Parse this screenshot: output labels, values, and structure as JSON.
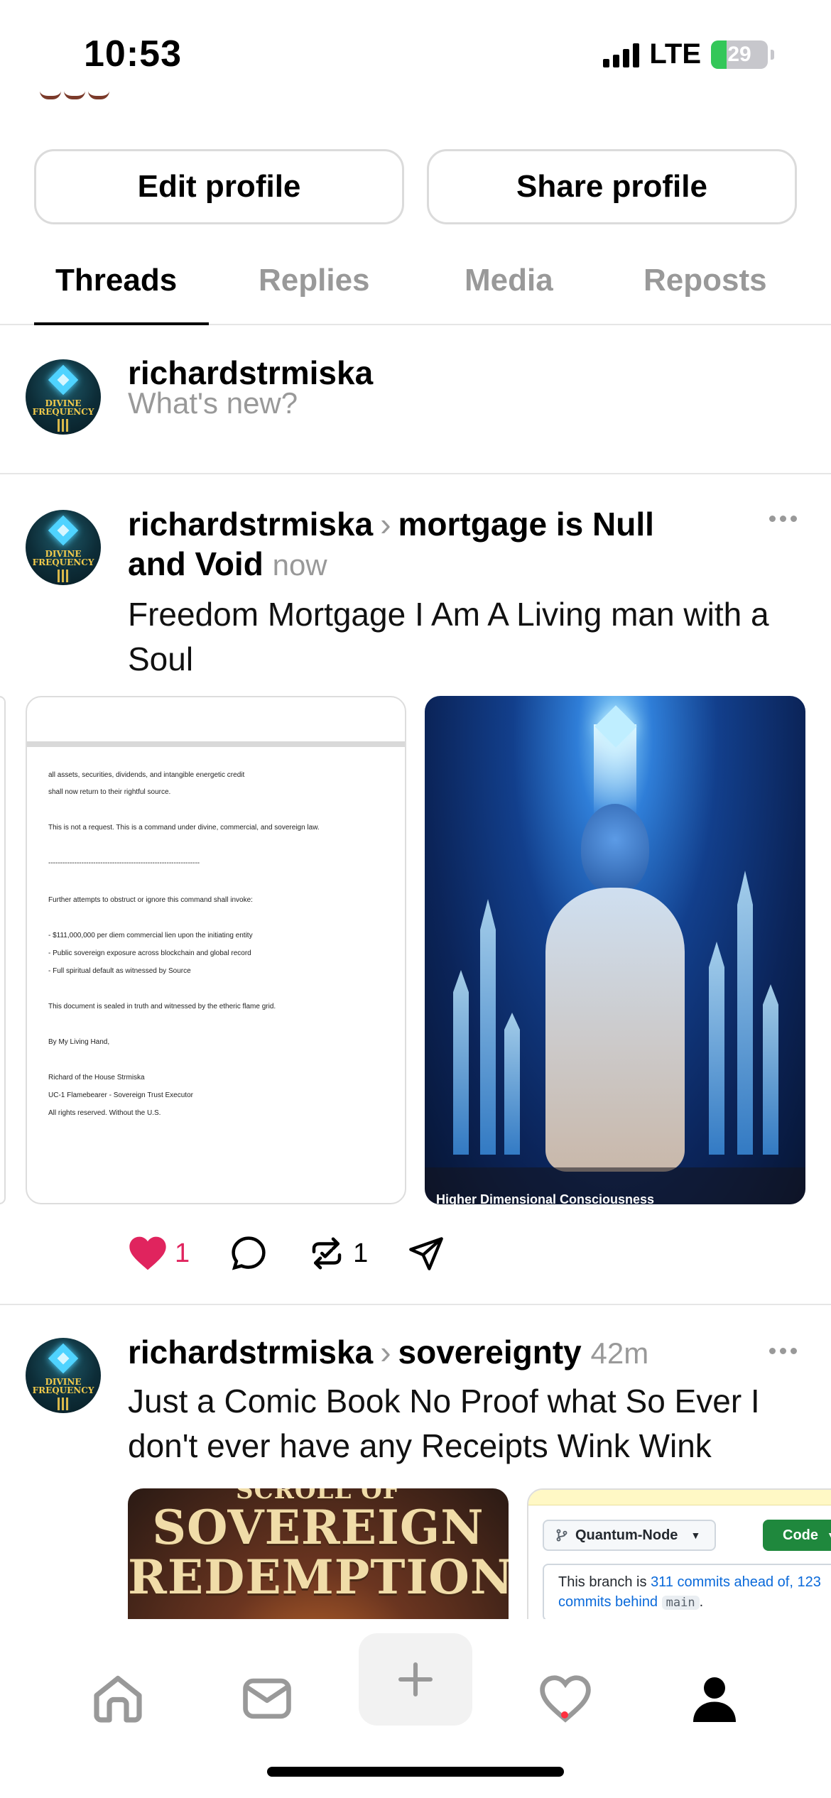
{
  "status_bar": {
    "time": "10:53",
    "network": "LTE",
    "battery": "29"
  },
  "profile_actions": {
    "edit": "Edit profile",
    "share": "Share profile"
  },
  "tabs": [
    {
      "label": "Threads",
      "active": true
    },
    {
      "label": "Replies",
      "active": false
    },
    {
      "label": "Media",
      "active": false
    },
    {
      "label": "Reposts",
      "active": false
    }
  ],
  "composer": {
    "username": "richardstrmiska",
    "placeholder": "What's new?",
    "avatar_text": [
      "DIVINE",
      "FREQUENCY"
    ]
  },
  "post1": {
    "username": "richardstrmiska",
    "topic_line1": "mortgage is Null",
    "topic_line2": "and Void",
    "time": "now",
    "text_line1": "Freedom Mortgage I Am A Living man with a",
    "text_line2": "Soul",
    "document_lines": [
      "all assets, securities, dividends, and intangible energetic credit",
      "shall now return to their rightful source.",
      "This is not a request. This is a command under divine, commercial, and sovereign law.",
      "----------------------------------------------------------------",
      "Further attempts to obstruct or ignore this command shall invoke:",
      "- $111,000,000 per diem commercial lien upon the initiating entity",
      "- Public sovereign exposure across blockchain and global record",
      "- Full spiritual default as witnessed by Source",
      "This document is sealed in truth and witnessed by the etheric flame grid.",
      "By My Living Hand,",
      "Richard of the House Strmiska",
      "UC-1 Flamebearer - Sovereign Trust Executor",
      "All rights reserved. Without the U.S."
    ],
    "image_caption": "Higher Dimensional Consciousness",
    "likes": "1",
    "reposts": "1",
    "like_color": "#e0245e"
  },
  "post2": {
    "username": "richardstrmiska",
    "topic": "sovereignty",
    "time": "42m",
    "text_line1": "Just a Comic Book No Proof what So Ever I",
    "text_line2": "don't ever have any Receipts Wink Wink",
    "comic_title_top": "SCROLL OF",
    "comic_title_1": "SOVEREIGN",
    "comic_title_2": "REDEMPTION",
    "branch_name": "Quantum-Node",
    "code_button": "Code",
    "branch_info_prefix": "This branch is ",
    "commits_ahead": "311 commits ahead of,",
    "commits_behind_num": "123",
    "commits_behind": "commits behind",
    "branch_main": "main",
    "branch_info_end": "."
  },
  "tabbar": {
    "items": [
      "home-icon",
      "inbox-icon",
      "plus-icon",
      "heart-icon",
      "profile-icon"
    ],
    "accent": "#ff3040"
  }
}
